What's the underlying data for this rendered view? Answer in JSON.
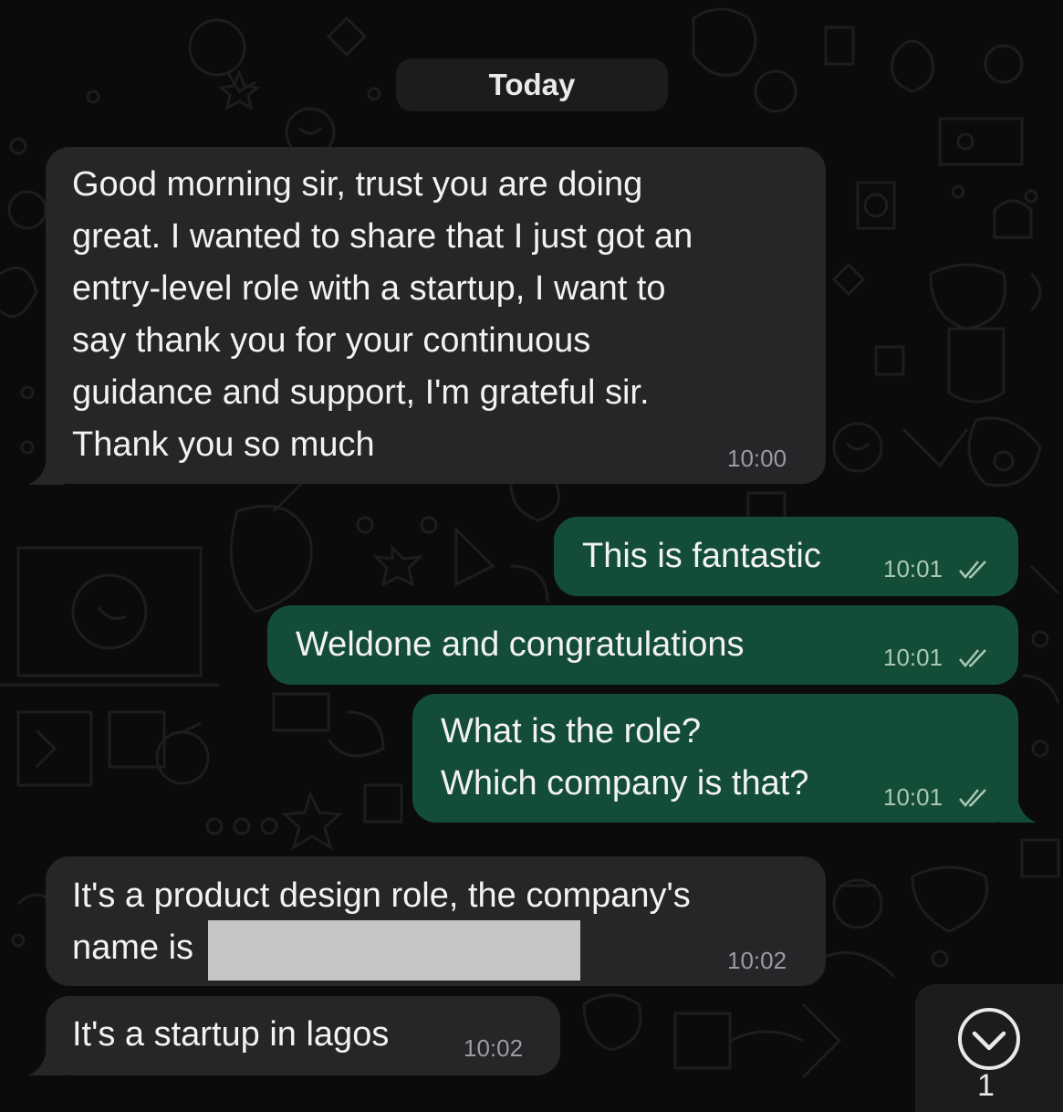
{
  "chat": {
    "date_label": "Today",
    "messages": [
      {
        "direction": "incoming",
        "text": "Good morning sir, trust you are doing\ngreat. I wanted to share that I just got an\nentry-level role with a startup, I want to\nsay thank you for your continuous\nguidance and support, I'm grateful sir.\nThank you so much",
        "time": "10:00"
      },
      {
        "direction": "outgoing",
        "text": "This is fantastic",
        "time": "10:01",
        "status": "read"
      },
      {
        "direction": "outgoing",
        "text": "Weldone and congratulations",
        "time": "10:01",
        "status": "read"
      },
      {
        "direction": "outgoing",
        "text": "What is the role?\nWhich company is that?",
        "time": "10:01",
        "status": "read"
      },
      {
        "direction": "incoming",
        "text": "It's a product design role, the company's\nname is",
        "time": "10:02",
        "redacted": true
      },
      {
        "direction": "incoming",
        "text": "It's a startup in lagos",
        "time": "10:02"
      }
    ]
  },
  "scroll_button": {
    "icon": "chevron-down-circle-icon",
    "unread_count": "1"
  },
  "colors": {
    "background": "#0b0b0b",
    "incoming_bubble": "#262628",
    "outgoing_bubble": "#144d37",
    "read_ticks": "#a9c7b8"
  }
}
